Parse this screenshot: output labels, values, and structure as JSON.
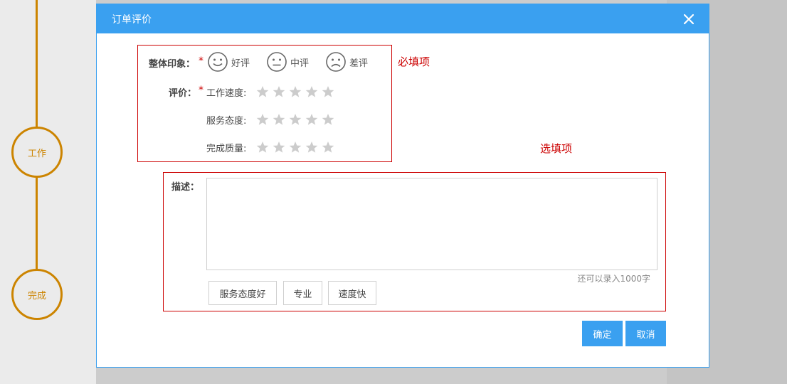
{
  "timeline": {
    "steps": [
      {
        "label": "工作"
      },
      {
        "label": "完成"
      }
    ]
  },
  "modal": {
    "title": "订单评价",
    "overall": {
      "label": "整体印象：",
      "asterisk": "*",
      "options": [
        "好评",
        "中评",
        "差评"
      ]
    },
    "rating": {
      "label": "评价：",
      "asterisk": "*",
      "rows": [
        {
          "label": "工作速度:",
          "stars": 0,
          "max": 5
        },
        {
          "label": "服务态度:",
          "stars": 0,
          "max": 5
        },
        {
          "label": "完成质量:",
          "stars": 0,
          "max": 5
        }
      ]
    },
    "required_note": "必填项",
    "optional_note": "选填项",
    "description": {
      "label": "描述：",
      "value": "",
      "hint": "还可以录入1000字"
    },
    "tags": [
      "服务态度好",
      "专业",
      "速度快"
    ],
    "buttons": {
      "confirm": "确定",
      "cancel": "取消"
    }
  },
  "colors": {
    "accent": "#3aa0f0",
    "timeline": "#cc8400",
    "required_border": "#cc0000",
    "star_empty": "#cccccc"
  }
}
